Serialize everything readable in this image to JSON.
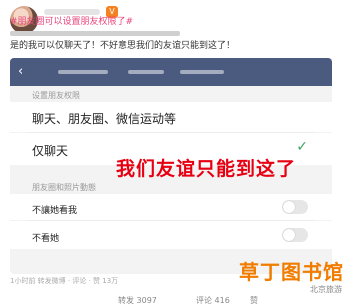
{
  "post": {
    "hashtag": "#朋友圈可以设置朋友权限了#",
    "body_visible": "是的我可以仅聊天了！不好意思我们的友谊只能到这了！",
    "body_accent": "可以"
  },
  "screenshot": {
    "section_title": "设置朋友权限",
    "option1": "聊天、朋友圈、微信运动等",
    "option2": "仅聊天",
    "overlay": "我们友谊只能到这了",
    "section2_title": "朋友圈和照片動態",
    "option3": "不讓她看我",
    "option4": "不看她"
  },
  "meta": {
    "footer": "1小时前 转发微博 · 评论 · 赞 13万",
    "repost": "转发 3097",
    "comment": "评论 416",
    "like": "赞"
  },
  "watermark": {
    "title": "草丁图书馆",
    "url": "北京旅游"
  }
}
